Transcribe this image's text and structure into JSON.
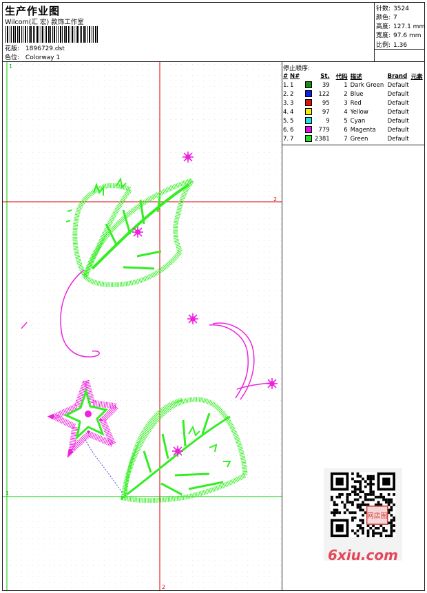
{
  "header": {
    "title": "生产作业图",
    "company": "Wilcom(汇 宏) 款饰工作室",
    "design_label": "花版:",
    "design_value": "1896729.dst",
    "color_label": "色位:",
    "color_value": "Colorway 1"
  },
  "stats": {
    "stitches_label": "针数:",
    "stitches": "3524",
    "colors_label": "颜色:",
    "colors": "7",
    "height_label": "高度:",
    "height": "127.1 mm",
    "width_label": "宽度:",
    "width": "97.6 mm",
    "scale_label": "比例:",
    "scale": "1.36"
  },
  "sequence": {
    "title": "停止顺序:",
    "columns": [
      "#",
      "N#",
      "",
      "St.",
      "代码",
      "描述",
      "Brand",
      "元素"
    ],
    "rows": [
      {
        "idx": "1.",
        "n": "1",
        "color": "#1a8a1a",
        "st": "39",
        "code": "1",
        "desc": "Dark Green",
        "brand": "Default"
      },
      {
        "idx": "2.",
        "n": "2",
        "color": "#1020e0",
        "st": "122",
        "code": "2",
        "desc": "Blue",
        "brand": "Default"
      },
      {
        "idx": "3.",
        "n": "3",
        "color": "#e01010",
        "st": "95",
        "code": "3",
        "desc": "Red",
        "brand": "Default"
      },
      {
        "idx": "4.",
        "n": "4",
        "color": "#f0f000",
        "st": "97",
        "code": "4",
        "desc": "Yellow",
        "brand": "Default"
      },
      {
        "idx": "5.",
        "n": "5",
        "color": "#20e0e0",
        "st": "9",
        "code": "5",
        "desc": "Cyan",
        "brand": "Default"
      },
      {
        "idx": "6.",
        "n": "6",
        "color": "#e010e0",
        "st": "779",
        "code": "6",
        "desc": "Magenta",
        "brand": "Default"
      },
      {
        "idx": "7.",
        "n": "7",
        "color": "#20e020",
        "st": "2381",
        "code": "7",
        "desc": "Green",
        "brand": "Default"
      }
    ]
  },
  "guides": {
    "green_left_label": "1",
    "green_bottom_label": "1",
    "red_horizontal_label": "2",
    "red_vertical_label": "2"
  },
  "colors": {
    "green_thread": "#33ee22",
    "magenta_thread": "#ee22dd",
    "guide_red": "#dd0000",
    "guide_green": "#00cc00"
  },
  "watermark": {
    "text": "6xiu.com",
    "qr_badge": "网店图"
  }
}
